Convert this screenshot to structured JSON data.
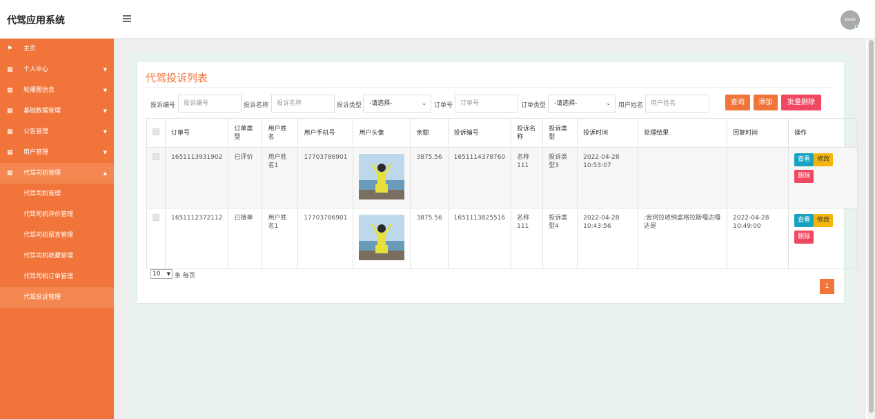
{
  "app": {
    "title": "代驾应用系统",
    "avatar_text": "80x80"
  },
  "sidebar": {
    "items": [
      {
        "label": "主页",
        "icon": "flag-icon"
      },
      {
        "label": "个人中心",
        "icon": "grid-icon"
      },
      {
        "label": "轮播图信息",
        "icon": "grid-icon"
      },
      {
        "label": "基础数据管理",
        "icon": "grid-icon"
      },
      {
        "label": "公告管理",
        "icon": "grid-icon"
      },
      {
        "label": "用户管理",
        "icon": "grid-icon"
      },
      {
        "label": "代驾司机管理",
        "icon": "grid-icon"
      }
    ],
    "sub_items": [
      {
        "label": "代驾司机管理"
      },
      {
        "label": "代驾司机评价管理"
      },
      {
        "label": "代驾司机留言管理"
      },
      {
        "label": "代驾司机收藏管理"
      },
      {
        "label": "代驾司机订单管理"
      },
      {
        "label": "代驾投诉管理"
      }
    ]
  },
  "page": {
    "title": "代驾投诉列表"
  },
  "search": {
    "complaint_no_label": "投诉编号",
    "complaint_no_placeholder": "投诉编号",
    "complaint_name_label": "投诉名称",
    "complaint_name_placeholder": "投诉名称",
    "complaint_type_label": "投诉类型",
    "complaint_type_value": "-请选择-",
    "order_no_label": "订单号",
    "order_no_placeholder": "订单号",
    "order_type_label": "订单类型",
    "order_type_value": "-请选择-",
    "user_name_label": "用户姓名",
    "user_name_placeholder": "用户姓名",
    "query_label": "查询",
    "add_label": "添加",
    "batch_delete_label": "批量删除"
  },
  "table": {
    "headers": [
      "订单号",
      "订单类型",
      "用户姓名",
      "用户手机号",
      "用户头像",
      "余额",
      "投诉编号",
      "投诉名称",
      "投诉类型",
      "投诉时间",
      "处理结果",
      "回复时间",
      "操作"
    ],
    "rows": [
      {
        "order_no": "1651113931902",
        "order_type": "已评价",
        "user_name": "用户姓名1",
        "phone": "17703786901",
        "balance": "3875.56",
        "complaint_no": "1651114378760",
        "complaint_name": "名称111",
        "complaint_type": "投诉类型3",
        "complaint_time": "2022-04-28 10:53:07",
        "result": "",
        "reply_time": ""
      },
      {
        "order_no": "1651112372112",
        "order_type": "已接单",
        "user_name": "用户姓名1",
        "phone": "17703786901",
        "balance": "3875.56",
        "complaint_no": "1651113825516",
        "complaint_name": "名称111",
        "complaint_type": "投诉类型4",
        "complaint_time": "2022-04-28 10:43:56",
        "result": ";金珂拉收纳盒格拉斯嘎达嘎达是",
        "reply_time": "2022-04-28 10:49:00"
      }
    ],
    "view_label": "查看",
    "edit_label": "修改",
    "delete_label": "删除"
  },
  "pager": {
    "page_size": "10",
    "per_page_text": "条 每页",
    "current_page": "1"
  },
  "colors": {
    "accent": "#f1753a",
    "danger": "#f04860",
    "info": "#1aa3c0",
    "warning": "#f5b50c"
  }
}
